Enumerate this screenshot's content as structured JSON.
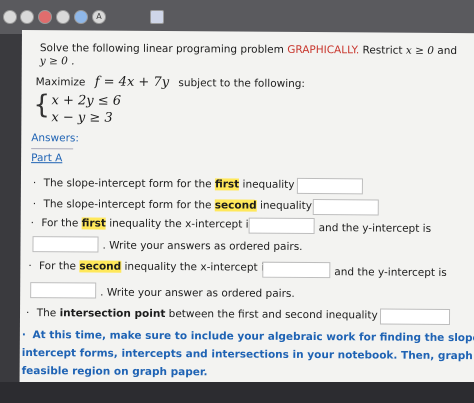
{
  "toolbar": {
    "icons": [
      "back-icon",
      "forward-icon",
      "close-icon",
      "check-icon",
      "pin-icon",
      "text-icon",
      "calendar-icon"
    ],
    "labels": [
      "",
      "",
      "",
      "",
      "",
      "A",
      ""
    ]
  },
  "problem": {
    "intro": "Solve the following linear programing problem",
    "method": "GRAPHICALLY.",
    "restrict": "Restrict",
    "cond1": "x ≥ 0",
    "and": "and",
    "cond2": "y ≥ 0 ."
  },
  "objective": {
    "maximize": "Maximize",
    "formula": "f = 4x + 7y",
    "subject": "subject to the following:"
  },
  "constraints": [
    "x + 2y ≤ 6",
    "x − y ≥ 3"
  ],
  "answers_label": "Answers:",
  "part_a": "Part A",
  "q1": {
    "pre": "The slope-intercept form for the",
    "key": "first",
    "post": "inequality is"
  },
  "q2": {
    "pre": "The slope-intercept form for the",
    "key": "second",
    "post": "inequality is"
  },
  "q3": {
    "pre": "For the",
    "key": "first",
    "mid": "inequality the x-intercept is",
    "and": "and the y-intercept is",
    "note": ". Write your answers as ordered pairs."
  },
  "q4": {
    "pre": "For the",
    "key": "second",
    "mid": "inequality the x-intercept is",
    "and": "and the y-intercept is",
    "note": ". Write your answer as ordered pairs."
  },
  "q5": {
    "pre": "The",
    "key": "intersection point",
    "post": "between the first and second inequality is"
  },
  "note": "At this time, make sure to include your algebraic work for finding the slope-intercept forms, intercepts and intersections in your notebook. Then, graph the feasible region on graph paper.",
  "note_lines": [
    "At this time, make sure to include your algebraic work for finding the slope-",
    "intercept forms, intercepts and intersections in your notebook. Then, graph the",
    "feasible region on graph paper."
  ]
}
